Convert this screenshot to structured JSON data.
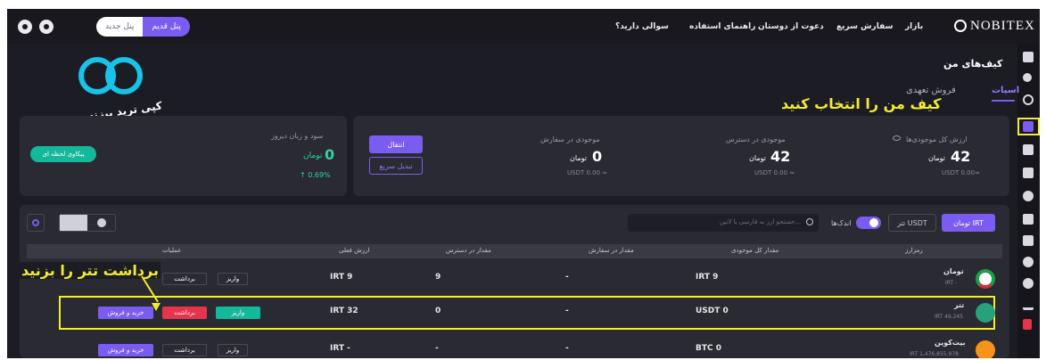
{
  "topbar": {
    "logo": "NOBITEX",
    "nav": [
      "بازار",
      "سفارش سریع",
      "دعوت از دوستان",
      "راهنمای استفاده",
      "سوالی دارید؟"
    ],
    "panel_old": "پنل قدیم",
    "panel_new": "پنل جدید"
  },
  "page": {
    "title": "کیف‌های من",
    "tabs": [
      "اسپات",
      "فروش تعهدی"
    ]
  },
  "summary": {
    "total_label": "ارزش کل موجودی‌ها",
    "total_value": "42",
    "total_unit": "تومان",
    "total_usdt": "USDT 0.00≈",
    "available_label": "موجودی در دسترس",
    "available_value": "42",
    "available_unit": "تومان",
    "available_usdt": "USDT 0.00 ≈",
    "order_label": "موجودی در سفارش",
    "order_value": "0",
    "order_unit": "تومان",
    "order_usdt": "USDT 0.00 ≈",
    "transfer_btn": "انتقال",
    "quick_convert_btn": "تبدیل سریع"
  },
  "profit": {
    "label": "سود و زیان دیروز",
    "value": "0",
    "unit": "تومان",
    "change": "↑ 0.69%",
    "chart_btn": "پیکاوی لحظه ای"
  },
  "watermark": {
    "brand": "کپی ترید بیزنس"
  },
  "filters": {
    "tab_irt": "تومان IRT",
    "tab_usdt": "تتر USDT",
    "small_label": "اندک‌ها",
    "search_placeholder": "جستجو ارز به فارسی یا لاتین..."
  },
  "table": {
    "headers": [
      "رمزارز",
      "مقدار کل موجودی",
      "مقدار در سفارش",
      "مقدار در دسترس",
      "ارزش فعلی",
      "عملیات"
    ],
    "rows": [
      {
        "name": "تومان",
        "code": "IRT -",
        "total": "IRT 9",
        "order": "-",
        "available": "9",
        "value": "IRT 9",
        "actions": [
          "برداشت",
          "واریز"
        ]
      },
      {
        "name": "تتر",
        "code": "IRT 49,245",
        "total": "USDT 0",
        "order": "-",
        "available": "0",
        "value": "IRT 32",
        "actions": [
          "خرید و فروش",
          "برداشت",
          "واریز"
        ]
      },
      {
        "name": "بیت‌کوین",
        "code": "IRT 1,476,855,978",
        "total": "BTC 0",
        "order": "-",
        "available": "-",
        "value": "IRT -",
        "actions": [
          "خرید و فروش",
          "برداشت",
          "واریز"
        ]
      }
    ]
  },
  "annotations": {
    "select_wallet": "کیف من را انتخاب کنید",
    "withdraw_tether": "برداشت تتر را بزنید"
  },
  "colors": {
    "accent_purple": "#7b5cf0",
    "teal": "#14b89a",
    "red": "#e8344a",
    "annotation_yellow": "#f2ee2a"
  }
}
